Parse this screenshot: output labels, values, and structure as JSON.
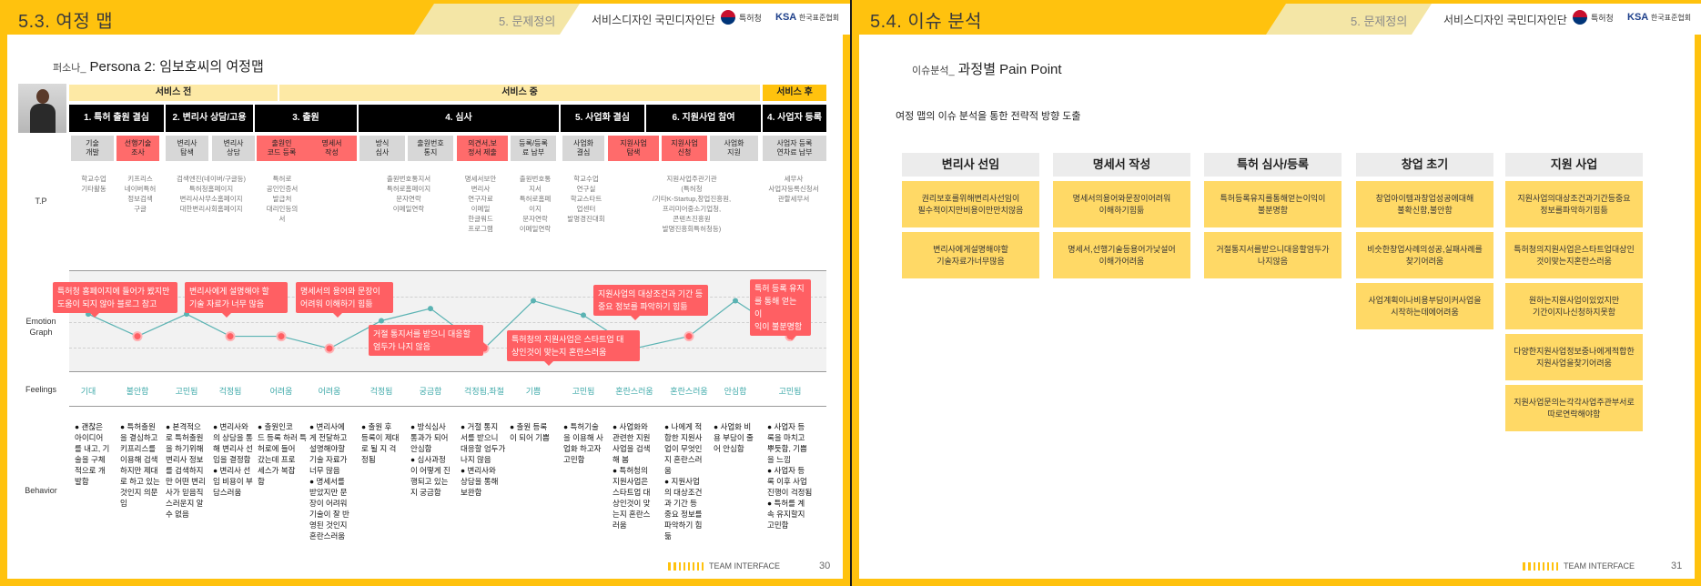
{
  "left": {
    "header_title": "5.3. 여정 맵",
    "section": "5. 문제정의",
    "program": "서비스디자인 국민디자인단",
    "kipo": "특허청",
    "ksa": "KSA",
    "ksa_name": "한국표준협회",
    "footer_brand": "TEAM INTERFACE",
    "page_number": "30",
    "persona_prefix": "퍼소나_",
    "persona_title": "Persona 2: 임보호씨의 여정맵",
    "phases": [
      "서비스 전",
      "서비스 중",
      "서비스 후"
    ],
    "stages": [
      "1. 특허 출원 결심",
      "2. 변리사 상담/고용",
      "3. 출원",
      "4. 심사",
      "5. 사업화 결심",
      "6. 지원사업 참여",
      "4. 사업자 등록"
    ],
    "touchpoints": [
      "기술\n개발",
      "선행기술\n조사",
      "변리사\n탐색",
      "변리사\n상담",
      "출원인\n코드 등록",
      "명세서\n작성",
      "방식\n심사",
      "출원번호\n통지",
      "의견서,보\n정서 제출",
      "등록/등록\n료 납부",
      "사업화\n결심",
      "지원사업\n탐색",
      "지원사업\n신청",
      "사업화\n지원",
      "사업자 등록\n연차료 납부"
    ],
    "row_labels": {
      "tp": "T.P",
      "emotion": "Emotion\nGraph",
      "feelings": "Feelings",
      "behavior": "Behavior"
    },
    "tips": [
      "학교수업\n기타활동",
      "키프리스\n네이버특허\n정보검색\n구글",
      "검색엔진(네이버/구글등)\n특허청홈페이지\n변리사사무소홈페이지\n대한변리사회홈페이지",
      "특허로\n공인인증서\n발급처\n대리인등의\n서",
      "출원번호통지서\n특허로홈페이지\n문자연락\n이메일연락",
      "명세서보안\n변리사\n연구자료\n이메일\n한글워드\n프로그램",
      "출원번호통\n지서\n특허로홈페\n이지\n문자연락\n이메일연락",
      "학교수업\n연구실\n학교스타트\n업센터\n발명경진대회",
      "지원사업주관기관\n(특허청\n/기타K-Startup,창업진흥원,\n프리미어중소기업청,\n콘텐츠진흥원\n발명진흥회특허청등)",
      "세무사\n사업자등록신청서\n관할세무서"
    ],
    "bubbles": [
      "특허청 홈페이지에 들어가 봤지만\n도움이 되지 않아 블로그 참고",
      "변리사에게 설명해야 할\n기술 자료가 너무 많음",
      "명세서의 용어와 문장이\n어려워 이해하기 힘듦",
      "거절 통지서를 받으니 대응할\n엄두가 나지 않음",
      "특허청의 지원사업은 스타트업 대\n상인것이 맞는지 혼란스러움",
      "지원사업의 대상조건과 기간 등\n중요 정보를 파악하기 힘듦",
      "특허 등록 유지\n를 통해 얻는 이\n익이 불분명함"
    ],
    "feelings": [
      "기대",
      "불안함",
      "고민됨",
      "걱정됨",
      "어려움",
      "어려움",
      "걱정됨",
      "궁금함",
      "걱정됨,좌절",
      "기쁨",
      "고민됨",
      "혼란스러움",
      "혼란스러움",
      "안심함",
      "고민됨"
    ],
    "emotion_levels": [
      0.62,
      0.22,
      0.62,
      0.22,
      0.22,
      0.0,
      0.5,
      0.72,
      0.0,
      0.86,
      0.6,
      0.0,
      0.22,
      0.86,
      0.22
    ],
    "behaviors": [
      "● 괜찮은\n아이디어\n를 내고, 기\n술을 구체\n적으로 개\n발함",
      "● 특허출원\n을 결심하고\n키프리스를\n이용해 검색\n하지만 제대\n로 하고 있는\n것인지 의문\n임",
      "● 본격적으\n로 특허출원\n을 하기위해\n변리사 정보\n를 검색하지\n만 어떤 변리\n사가 믿음직\n스러운지 알\n수 없음",
      "● 변리사와\n의 상담을 통\n해 변리사 선\n임을 결정함\n● 변리사 선\n임 비용이 부\n담스러움",
      "● 출원인코\n드 등록 하러 특\n허로에 들어\n갔는데 프로\n세스가 복잡\n함",
      "● 변리사에\n게 전달하고\n설명해야할\n기술 자료가\n너무 많음\n● 명세서를\n받았지만 문\n장이 어려워\n기술이 잘 반\n영된 것인지\n혼란스러움",
      "● 출원 후\n등록이 제대\n로 될 지 걱\n정됨",
      "● 방식심사\n통과가 되어\n안심함\n● 심사과정\n이 어떻게 진\n행되고 있는\n지 궁금함",
      "● 거절 통지\n서를 받으니\n대응할 엄두가\n나지 않음\n● 변리사와\n상담을 통해\n보완함",
      "● 출원 등록\n이 되어 기쁨",
      "● 특허기술\n을 이용해 사\n업화 하고자\n고민함",
      "● 사업화와\n관련한 지원\n사업을 검색\n해 봄\n● 특허청의\n지원사업은\n스타트업 대\n상인것이 맞\n는지 혼란스\n러움",
      "● 나에게 적\n합한 지원사\n업이 무엇인\n지 혼란스러\n움\n● 지원사업\n의 대상조건\n과 기간 등\n중요 정보를\n파악하기 힘\n듦",
      "● 사업화 비\n용 부담이 줄\n어 안심함",
      "● 사업자 등\n록을 마치고\n뿌듯함, 기쁨\n을 느낌\n● 사업자 등\n록 이후 사업\n진행이 걱정됨\n● 특허를 계\n속 유지할지\n고민함"
    ],
    "colors": {
      "accent": "#ffc20e",
      "phase_light": "#fde9a5",
      "pain_red": "#ff5f63",
      "emotion_line": "#5bb3b3"
    }
  },
  "right": {
    "header_title": "5.4. 이슈 분석",
    "section": "5. 문제정의",
    "program": "서비스디자인 국민디자인단",
    "kipo": "특허청",
    "ksa": "KSA",
    "ksa_name": "한국표준협회",
    "footer_brand": "TEAM INTERFACE",
    "page_number": "31",
    "issue_prefix": "이슈분석_",
    "issue_title": "과정별 Pain Point",
    "subtitle": "여정 맵의 이슈 분석을 통한 전략적 방향 도출",
    "columns": [
      {
        "title": "변리사 선임",
        "items": [
          "권리보호를위해변리사선임이\n필수적이지만비용이만만치않음",
          "변리사에게설명해야할\n기술자료가너무많음"
        ]
      },
      {
        "title": "명세서 작성",
        "items": [
          "명세서의용어와문장이어려워\n이해하기힘듦",
          "명세서,선행기술등용어가낯설어\n이해가어려움"
        ]
      },
      {
        "title": "특허 심사/등록",
        "items": [
          "특허등록유지를통해얻는이익이\n불분명함",
          "거절통지서를받으니대응할엄두가\n나지않음"
        ]
      },
      {
        "title": "창업 초기",
        "items": [
          "창업아이템과창업성공에대해\n불확신함,불안함",
          "비슷한창업사례의성공,실패사례를\n찾기어려움",
          "사업계획이나비용부담이커사업을\n시작하는데에어려움"
        ]
      },
      {
        "title": "지원 사업",
        "items": [
          "지원사업의대상조건과기간등중요\n정보를파악하기힘듦",
          "특허청의지원사업은스타트업대상인\n것이맞는지혼란스러움",
          "원하는지원사업이있었지만\n기간이지나신청하지못함",
          "다양한지원사업정보중나에게적합한\n지원사업을찾기어려움",
          "지원사업문의는각각사업주관부서로\n따로연락해야함"
        ]
      }
    ]
  }
}
